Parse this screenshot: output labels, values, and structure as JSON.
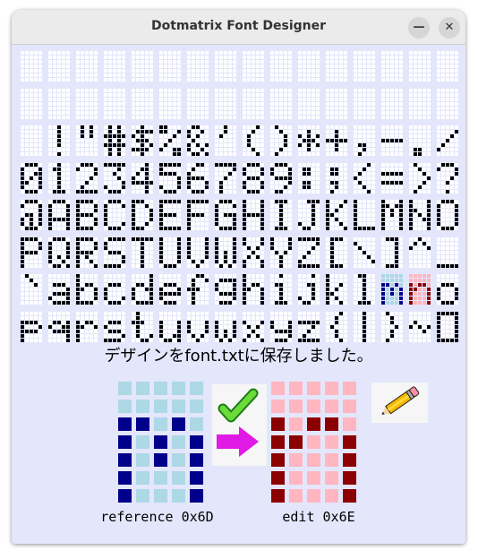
{
  "window": {
    "title": "Dotmatrix Font Designer",
    "minimize_glyph": "—",
    "close_glyph": "✕"
  },
  "colors": {
    "window_bg": "#e4e6fb",
    "grid_off": "#ffffff",
    "grid_on": "#000000",
    "ref_off": "#add8e6",
    "ref_on": "#00008b",
    "edit_off": "#ffb6c1",
    "edit_on": "#8b0000"
  },
  "font_grid": {
    "columns": 16,
    "rows": 8,
    "glyph_columns": 5,
    "glyph_rows": 7,
    "reference_code": "0x6D",
    "edit_code": "0x6E",
    "glyphs": {
      "0x21": [
        "00100",
        "00100",
        "00100",
        "00100",
        "00100",
        "00000",
        "00100"
      ],
      "0x22": [
        "01010",
        "01010",
        "01010",
        "00000",
        "00000",
        "00000",
        "00000"
      ],
      "0x23": [
        "01010",
        "01010",
        "11111",
        "01010",
        "11111",
        "01010",
        "01010"
      ],
      "0x24": [
        "00100",
        "01111",
        "10100",
        "01110",
        "00101",
        "11110",
        "00100"
      ],
      "0x25": [
        "11000",
        "11001",
        "00010",
        "00100",
        "01000",
        "10011",
        "00011"
      ],
      "0x26": [
        "01100",
        "10010",
        "10100",
        "01000",
        "10101",
        "10010",
        "01101"
      ],
      "0x27": [
        "00100",
        "00100",
        "01000",
        "00000",
        "00000",
        "00000",
        "00000"
      ],
      "0x28": [
        "00010",
        "00100",
        "01000",
        "01000",
        "01000",
        "00100",
        "00010"
      ],
      "0x29": [
        "01000",
        "00100",
        "00010",
        "00010",
        "00010",
        "00100",
        "01000"
      ],
      "0x2A": [
        "00000",
        "00100",
        "10101",
        "01110",
        "10101",
        "00100",
        "00000"
      ],
      "0x2B": [
        "00000",
        "00100",
        "00100",
        "11111",
        "00100",
        "00100",
        "00000"
      ],
      "0x2C": [
        "00000",
        "00000",
        "00000",
        "00000",
        "01100",
        "00100",
        "01000"
      ],
      "0x2D": [
        "00000",
        "00000",
        "00000",
        "11111",
        "00000",
        "00000",
        "00000"
      ],
      "0x2E": [
        "00000",
        "00000",
        "00000",
        "00000",
        "00000",
        "01100",
        "01100"
      ],
      "0x2F": [
        "00000",
        "00001",
        "00010",
        "00100",
        "01000",
        "10000",
        "00000"
      ],
      "0x30": [
        "01110",
        "10001",
        "10011",
        "10101",
        "11001",
        "10001",
        "01110"
      ],
      "0x31": [
        "00100",
        "01100",
        "00100",
        "00100",
        "00100",
        "00100",
        "01110"
      ],
      "0x32": [
        "01110",
        "10001",
        "00001",
        "00010",
        "00100",
        "01000",
        "11111"
      ],
      "0x33": [
        "11111",
        "00010",
        "00100",
        "00010",
        "00001",
        "10001",
        "01110"
      ],
      "0x34": [
        "00010",
        "00110",
        "01010",
        "10010",
        "11111",
        "00010",
        "00010"
      ],
      "0x35": [
        "11111",
        "10000",
        "11110",
        "00001",
        "00001",
        "10001",
        "01110"
      ],
      "0x36": [
        "00110",
        "01000",
        "10000",
        "11110",
        "10001",
        "10001",
        "01110"
      ],
      "0x37": [
        "11111",
        "00001",
        "00010",
        "00100",
        "01000",
        "01000",
        "01000"
      ],
      "0x38": [
        "01110",
        "10001",
        "10001",
        "01110",
        "10001",
        "10001",
        "01110"
      ],
      "0x39": [
        "01110",
        "10001",
        "10001",
        "01111",
        "00001",
        "00010",
        "01100"
      ],
      "0x3A": [
        "00000",
        "01100",
        "01100",
        "00000",
        "01100",
        "01100",
        "00000"
      ],
      "0x3B": [
        "00000",
        "01100",
        "01100",
        "00000",
        "01100",
        "00100",
        "01000"
      ],
      "0x3C": [
        "00010",
        "00100",
        "01000",
        "10000",
        "01000",
        "00100",
        "00010"
      ],
      "0x3D": [
        "00000",
        "00000",
        "11111",
        "00000",
        "11111",
        "00000",
        "00000"
      ],
      "0x3E": [
        "01000",
        "00100",
        "00010",
        "00001",
        "00010",
        "00100",
        "01000"
      ],
      "0x3F": [
        "01110",
        "10001",
        "00001",
        "00010",
        "00100",
        "00000",
        "00100"
      ],
      "0x40": [
        "01110",
        "10001",
        "00001",
        "01101",
        "10101",
        "10101",
        "01110"
      ],
      "0x41": [
        "01110",
        "10001",
        "10001",
        "10001",
        "11111",
        "10001",
        "10001"
      ],
      "0x42": [
        "11110",
        "10001",
        "10001",
        "11110",
        "10001",
        "10001",
        "11110"
      ],
      "0x43": [
        "01110",
        "10001",
        "10000",
        "10000",
        "10000",
        "10001",
        "01110"
      ],
      "0x44": [
        "11100",
        "10010",
        "10001",
        "10001",
        "10001",
        "10010",
        "11100"
      ],
      "0x45": [
        "11111",
        "10000",
        "10000",
        "11110",
        "10000",
        "10000",
        "11111"
      ],
      "0x46": [
        "11111",
        "10000",
        "10000",
        "11110",
        "10000",
        "10000",
        "10000"
      ],
      "0x47": [
        "01110",
        "10001",
        "10000",
        "10111",
        "10001",
        "10001",
        "01111"
      ],
      "0x48": [
        "10001",
        "10001",
        "10001",
        "11111",
        "10001",
        "10001",
        "10001"
      ],
      "0x49": [
        "01110",
        "00100",
        "00100",
        "00100",
        "00100",
        "00100",
        "01110"
      ],
      "0x4A": [
        "00111",
        "00010",
        "00010",
        "00010",
        "00010",
        "10010",
        "01100"
      ],
      "0x4B": [
        "10001",
        "10010",
        "10100",
        "11000",
        "10100",
        "10010",
        "10001"
      ],
      "0x4C": [
        "10000",
        "10000",
        "10000",
        "10000",
        "10000",
        "10000",
        "11111"
      ],
      "0x4D": [
        "10001",
        "11011",
        "10101",
        "10101",
        "10001",
        "10001",
        "10001"
      ],
      "0x4E": [
        "10001",
        "10001",
        "11001",
        "10101",
        "10011",
        "10001",
        "10001"
      ],
      "0x4F": [
        "01110",
        "10001",
        "10001",
        "10001",
        "10001",
        "10001",
        "01110"
      ],
      "0x50": [
        "11110",
        "10001",
        "10001",
        "11110",
        "10000",
        "10000",
        "10000"
      ],
      "0x51": [
        "01110",
        "10001",
        "10001",
        "10001",
        "10101",
        "10010",
        "01101"
      ],
      "0x52": [
        "11110",
        "10001",
        "10001",
        "11110",
        "10100",
        "10010",
        "10001"
      ],
      "0x53": [
        "01111",
        "10000",
        "10000",
        "01110",
        "00001",
        "00001",
        "11110"
      ],
      "0x54": [
        "11111",
        "00100",
        "00100",
        "00100",
        "00100",
        "00100",
        "00100"
      ],
      "0x55": [
        "10001",
        "10001",
        "10001",
        "10001",
        "10001",
        "10001",
        "01110"
      ],
      "0x56": [
        "10001",
        "10001",
        "10001",
        "10001",
        "10001",
        "01010",
        "00100"
      ],
      "0x57": [
        "10001",
        "10001",
        "10001",
        "10101",
        "10101",
        "10101",
        "01010"
      ],
      "0x58": [
        "10001",
        "10001",
        "01010",
        "00100",
        "01010",
        "10001",
        "10001"
      ],
      "0x59": [
        "10001",
        "10001",
        "10001",
        "01010",
        "00100",
        "00100",
        "00100"
      ],
      "0x5A": [
        "11111",
        "00001",
        "00010",
        "00100",
        "01000",
        "10000",
        "11111"
      ],
      "0x5B": [
        "01110",
        "01000",
        "01000",
        "01000",
        "01000",
        "01000",
        "01110"
      ],
      "0x5C": [
        "00000",
        "10000",
        "01000",
        "00100",
        "00010",
        "00001",
        "00000"
      ],
      "0x5D": [
        "01110",
        "00010",
        "00010",
        "00010",
        "00010",
        "00010",
        "01110"
      ],
      "0x5E": [
        "00100",
        "01010",
        "10001",
        "00000",
        "00000",
        "00000",
        "00000"
      ],
      "0x5F": [
        "00000",
        "00000",
        "00000",
        "00000",
        "00000",
        "00000",
        "11111"
      ],
      "0x60": [
        "01000",
        "00100",
        "00010",
        "00000",
        "00000",
        "00000",
        "00000"
      ],
      "0x61": [
        "00000",
        "00000",
        "01110",
        "00001",
        "01111",
        "10001",
        "01111"
      ],
      "0x62": [
        "10000",
        "10000",
        "10110",
        "11001",
        "10001",
        "10001",
        "11110"
      ],
      "0x63": [
        "00000",
        "00000",
        "01110",
        "10000",
        "10000",
        "10001",
        "01110"
      ],
      "0x64": [
        "00001",
        "00001",
        "01101",
        "10011",
        "10001",
        "10001",
        "01111"
      ],
      "0x65": [
        "00000",
        "00000",
        "01110",
        "10001",
        "11111",
        "10000",
        "01110"
      ],
      "0x66": [
        "00110",
        "01001",
        "01000",
        "11100",
        "01000",
        "01000",
        "01000"
      ],
      "0x67": [
        "00000",
        "01111",
        "10001",
        "10001",
        "01111",
        "00001",
        "01110"
      ],
      "0x68": [
        "10000",
        "10000",
        "10110",
        "11001",
        "10001",
        "10001",
        "10001"
      ],
      "0x69": [
        "00100",
        "00000",
        "01100",
        "00100",
        "00100",
        "00100",
        "01110"
      ],
      "0x6A": [
        "00010",
        "00000",
        "00110",
        "00010",
        "00010",
        "10010",
        "01100"
      ],
      "0x6B": [
        "10000",
        "10000",
        "10010",
        "10100",
        "11000",
        "10100",
        "10010"
      ],
      "0x6C": [
        "01100",
        "00100",
        "00100",
        "00100",
        "00100",
        "00100",
        "01110"
      ],
      "0x6D": [
        "00000",
        "00000",
        "11010",
        "10101",
        "10101",
        "10001",
        "10001"
      ],
      "0x6E": [
        "00000",
        "00000",
        "10110",
        "11001",
        "10001",
        "10001",
        "10001"
      ],
      "0x6F": [
        "00000",
        "00000",
        "01110",
        "10001",
        "10001",
        "10001",
        "01110"
      ],
      "0x70": [
        "00000",
        "00000",
        "11110",
        "10001",
        "11110",
        "10000",
        "10000"
      ],
      "0x71": [
        "00000",
        "00000",
        "01101",
        "10011",
        "01111",
        "00001",
        "00001"
      ],
      "0x72": [
        "00000",
        "00000",
        "10110",
        "11001",
        "10000",
        "10000",
        "10000"
      ],
      "0x73": [
        "00000",
        "00000",
        "01110",
        "10000",
        "01110",
        "00001",
        "11110"
      ],
      "0x74": [
        "01000",
        "01000",
        "11100",
        "01000",
        "01000",
        "01001",
        "00110"
      ],
      "0x75": [
        "00000",
        "00000",
        "10001",
        "10001",
        "10001",
        "10011",
        "01101"
      ],
      "0x76": [
        "00000",
        "00000",
        "10001",
        "10001",
        "10001",
        "01010",
        "00100"
      ],
      "0x77": [
        "00000",
        "00000",
        "10001",
        "10001",
        "10101",
        "10101",
        "01010"
      ],
      "0x78": [
        "00000",
        "00000",
        "10001",
        "01010",
        "00100",
        "01010",
        "10001"
      ],
      "0x79": [
        "00000",
        "00000",
        "10001",
        "10001",
        "01111",
        "00001",
        "01110"
      ],
      "0x7A": [
        "00000",
        "00000",
        "11111",
        "00010",
        "00100",
        "01000",
        "11111"
      ],
      "0x7B": [
        "00010",
        "00100",
        "00100",
        "01000",
        "00100",
        "00100",
        "00010"
      ],
      "0x7C": [
        "00100",
        "00100",
        "00100",
        "00100",
        "00100",
        "00100",
        "00100"
      ],
      "0x7D": [
        "01000",
        "00100",
        "00100",
        "00010",
        "00100",
        "00100",
        "01000"
      ],
      "0x7E": [
        "00000",
        "00000",
        "01000",
        "10101",
        "00010",
        "00000",
        "00000"
      ],
      "0x7F": [
        "11111",
        "10001",
        "10001",
        "10001",
        "10001",
        "10001",
        "11111"
      ]
    }
  },
  "status": {
    "message": "デザインをfont.txtに保存しました。"
  },
  "reference": {
    "label": "reference 0x6D"
  },
  "edit": {
    "label": "edit 0x6E"
  },
  "buttons": {
    "apply_icon": "check-and-arrow-icon",
    "draw_icon": "pencil-icon"
  }
}
